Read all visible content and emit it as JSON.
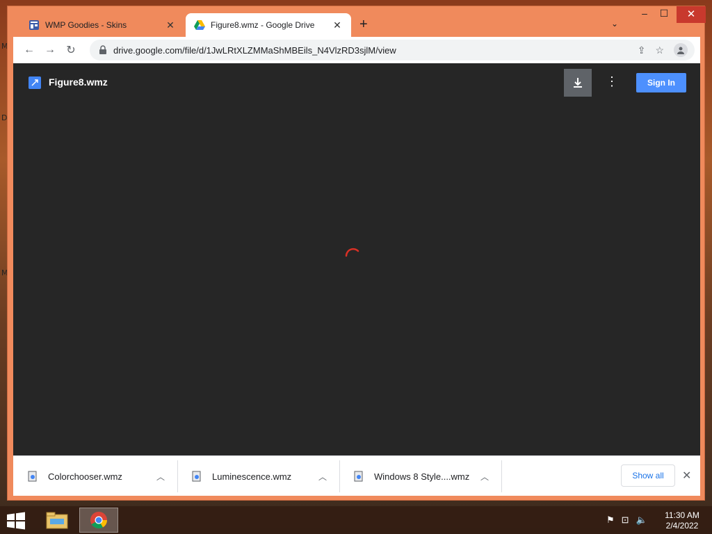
{
  "desktop": {
    "labels": [
      "M",
      "D",
      "M"
    ]
  },
  "tabs": [
    {
      "title": "WMP Goodies - Skins",
      "icon": "site-favicon-icon",
      "active": false
    },
    {
      "title": "Figure8.wmz - Google Drive",
      "icon": "google-drive-icon",
      "active": true
    }
  ],
  "toolbar": {
    "url": "drive.google.com/file/d/1JwLRtXLZMMaShMBEils_N4VlzRD3sjlM/view",
    "new_tab": "+",
    "tab_search": "⌄"
  },
  "viewer": {
    "file_name": "Figure8.wmz",
    "sign_in_label": "Sign In",
    "loading": true,
    "accent_color": "#4d90fe"
  },
  "downloads": {
    "items": [
      "Colorchooser.wmz",
      "Luminescence.wmz",
      "Windows 8 Style....wmz"
    ],
    "show_all_label": "Show all"
  },
  "taskbar": {
    "apps": [
      "file-explorer-icon",
      "chrome-icon"
    ],
    "time": "11:30 AM",
    "date": "2/4/2022"
  }
}
